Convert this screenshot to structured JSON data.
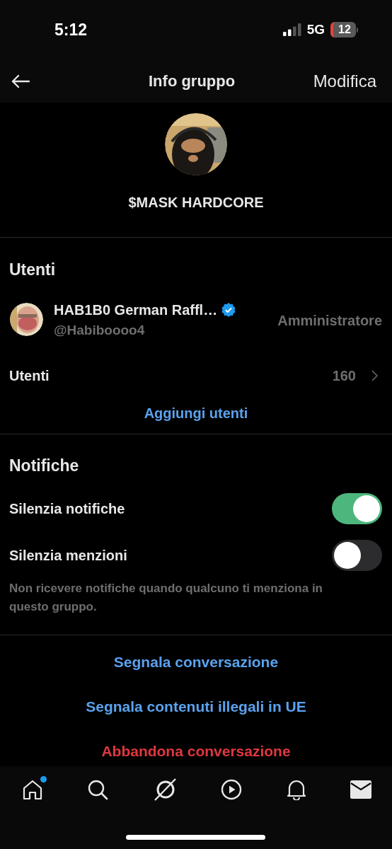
{
  "status_bar": {
    "time": "5:12",
    "network": "5G",
    "battery": "12"
  },
  "header": {
    "title": "Info gruppo",
    "action": "Modifica"
  },
  "group": {
    "name": "$MASK HARDCORE"
  },
  "users_section": {
    "title": "Utenti",
    "admin": {
      "name": "HAB1B0 German Raffl…",
      "verified": true,
      "handle": "@Habiboooo4",
      "role": "Amministratore"
    },
    "members_row": {
      "label": "Utenti",
      "count": "160"
    },
    "add_link": "Aggiungi utenti"
  },
  "notifications": {
    "title": "Notifiche",
    "toggles": [
      {
        "label": "Silenzia notifiche",
        "on": true
      },
      {
        "label": "Silenzia menzioni",
        "on": false
      }
    ],
    "description": "Non ricevere notifiche quando qualcuno ti menziona in questo gruppo."
  },
  "actions": [
    {
      "label": "Segnala conversazione",
      "kind": "link"
    },
    {
      "label": "Segnala contenuti illegali in UE",
      "kind": "link"
    },
    {
      "label": "Abbandona conversazione",
      "kind": "danger"
    }
  ],
  "tab_bar": {
    "items": [
      {
        "kind": "home",
        "badge": true
      },
      {
        "kind": "search",
        "badge": false
      },
      {
        "kind": "grok",
        "badge": false
      },
      {
        "kind": "video",
        "badge": false
      },
      {
        "kind": "notifications",
        "badge": false
      },
      {
        "kind": "messages",
        "badge": false
      }
    ]
  }
}
